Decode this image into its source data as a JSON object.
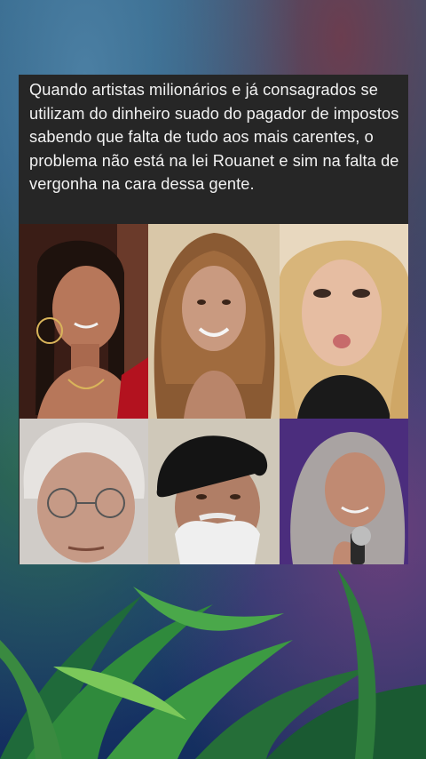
{
  "post": {
    "caption": "Quando artistas milionários e já consagrados se utilizam do dinheiro suado do pagador de impostos sabendo que falta de tudo aos mais carentes, o problema não está na lei Rouanet e sim na falta de vergonha na cara dessa gente."
  },
  "photos": [
    {
      "subject": "woman with braided hair and hoop earrings",
      "background": "#3a1d16",
      "skin": "#b7775a",
      "hair": "#1e120d"
    },
    {
      "subject": "woman with curly blonde hair",
      "background": "#d9c7a8",
      "skin": "#c99a80",
      "hair": "#8a5a33"
    },
    {
      "subject": "blonde woman blowing a kiss",
      "background": "#e8d8bf",
      "skin": "#e6bda2",
      "hair": "#d8b57a"
    },
    {
      "subject": "older man with glasses",
      "background": "#d0ccc8",
      "skin": "#c69a86",
      "hair": "#e6e3e0"
    },
    {
      "subject": "older bearded man in black beret",
      "background": "#cfc8b9",
      "skin": "#b07e66",
      "hair": "#efefef"
    },
    {
      "subject": "woman with grey hair singing into microphone",
      "background": "#4b2d7d",
      "skin": "#c08a72",
      "hair": "#a9a3a2"
    }
  ]
}
